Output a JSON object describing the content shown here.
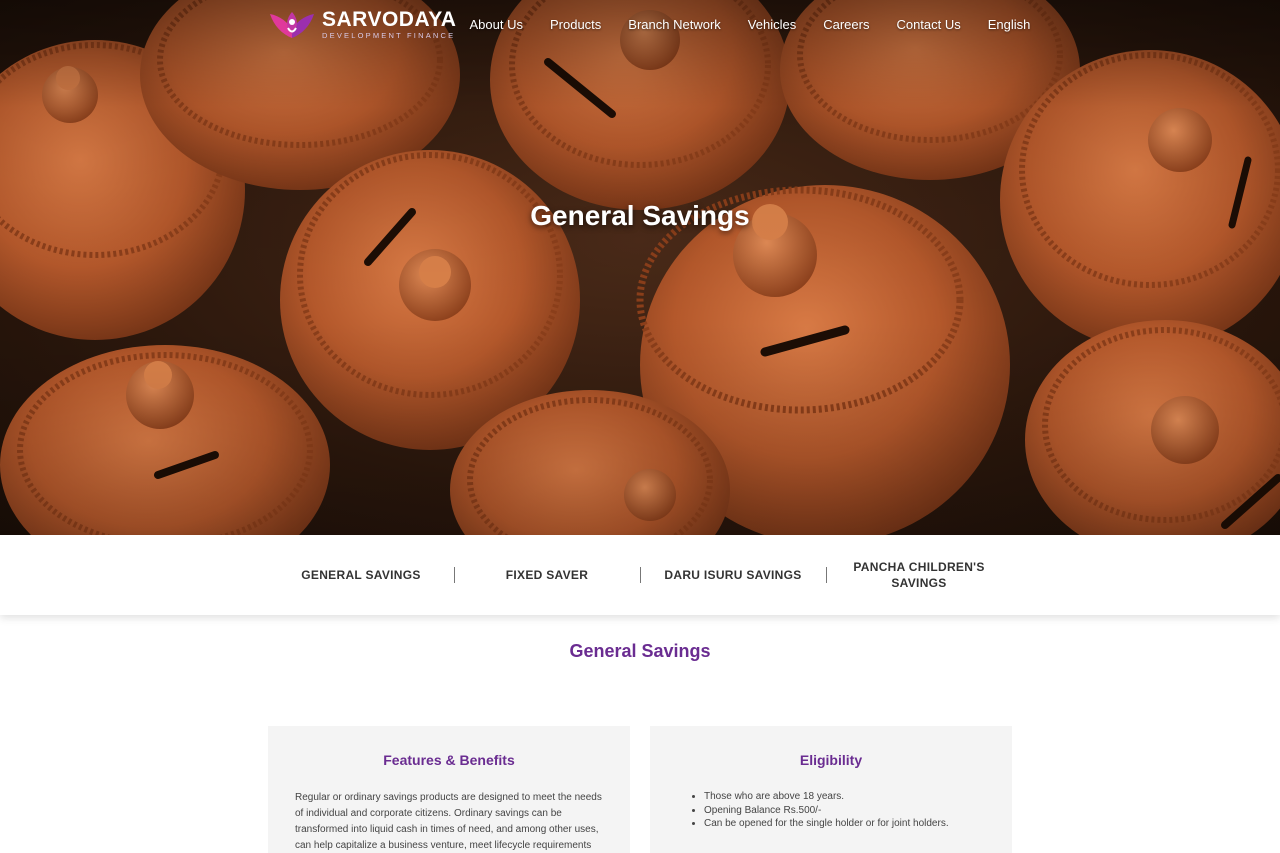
{
  "brand": {
    "name": "SARVODAYA",
    "tagline": "DEVELOPMENT FINANCE"
  },
  "nav": {
    "items": [
      "About Us",
      "Products",
      "Branch Network",
      "Vehicles",
      "Careers",
      "Contact Us",
      "English"
    ]
  },
  "hero": {
    "title": "General Savings"
  },
  "tabs": [
    {
      "label": "GENERAL SAVINGS"
    },
    {
      "label": "FIXED SAVER"
    },
    {
      "label": "DARU ISURU SAVINGS"
    },
    {
      "label": "PANCHA CHILDREN'S SAVINGS"
    }
  ],
  "section": {
    "title": "General Savings"
  },
  "features": {
    "title": "Features & Benefits",
    "body": "Regular or ordinary savings products are designed to meet the needs of individual and corporate citizens. Ordinary savings can be transformed into liquid cash in times of need, and among other uses, can help capitalize a business venture, meet lifecycle requirements"
  },
  "eligibility": {
    "title": "Eligibility",
    "items": [
      "Those who are above 18 years.",
      "Opening Balance Rs.500/-",
      "Can be opened for the single holder or for joint holders."
    ]
  },
  "colors": {
    "accent": "#6a2c91",
    "logo_pink": "#e0399b",
    "terracotta": "#b5562a"
  }
}
